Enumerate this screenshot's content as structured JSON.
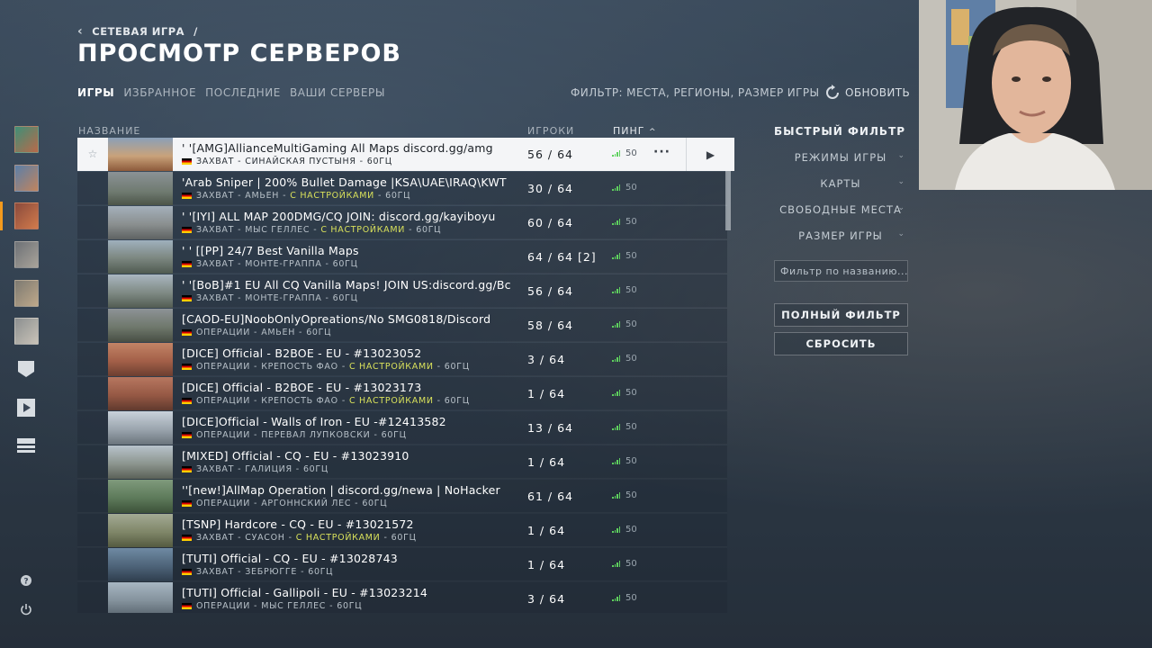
{
  "header": {
    "breadcrumb": "СЕТЕВАЯ ИГРА",
    "breadcrumb_sep": "/",
    "title": "ПРОСМОТР СЕРВЕРОВ"
  },
  "tabs": [
    {
      "label": "ИГРЫ",
      "active": true
    },
    {
      "label": "ИЗБРАННОЕ",
      "active": false
    },
    {
      "label": "ПОСЛЕДНИЕ",
      "active": false
    },
    {
      "label": "ВАШИ СЕРВЕРЫ",
      "active": false
    }
  ],
  "filter_summary": "ФИЛЬТР: МЕСТА, РЕГИОНЫ, РАЗМЕР ИГРЫ",
  "refresh_label": "ОБНОВИТЬ",
  "columns": {
    "name": "НАЗВАНИЕ",
    "players": "ИГРОКИ",
    "ping": "ПИНГ"
  },
  "servers": [
    {
      "name": "'    '[AMG]AllianceMultiGaming All Maps discord.gg/amg",
      "mode": "ЗАХВАТ",
      "map": "СИНАЙСКАЯ ПУСТЫНЯ",
      "custom": "",
      "hz": "60ГЦ",
      "players": "56 / 64",
      "ping": "50",
      "selected": true
    },
    {
      "name": " 'Arab Sniper | 200% Bullet Damage |KSA\\UAE\\IRAQ\\KWT",
      "mode": "ЗАХВАТ",
      "map": "АМЬЕН",
      "custom": "С НАСТРОЙКАМИ",
      "hz": "60ГЦ",
      "players": "30 / 64",
      "ping": "50",
      "selected": false
    },
    {
      "name": "'   '[IYI] ALL MAP 200DMG/CQ JOIN: discord.gg/kayiboyu",
      "mode": "ЗАХВАТ",
      "map": "МЫС ГЕЛЛЕС",
      "custom": "С НАСТРОЙКАМИ",
      "hz": "60ГЦ",
      "players": "60 / 64",
      "ping": "50",
      "selected": false
    },
    {
      "name": "' ' [[PP] 24/7 Best Vanilla Maps",
      "mode": "ЗАХВАТ",
      "map": "МОНТЕ-ГРАППА",
      "custom": "",
      "hz": "60ГЦ",
      "players": "64 / 64 [2]",
      "ping": "50",
      "selected": false
    },
    {
      "name": "' '[BoB]#1 EU All CQ Vanilla Maps! JOIN US:discord.gg/Bc",
      "mode": "ЗАХВАТ",
      "map": "МОНТЕ-ГРАППА",
      "custom": "",
      "hz": "60ГЦ",
      "players": "56 / 64",
      "ping": "50",
      "selected": false
    },
    {
      "name": "[CAOD-EU]NoobOnlyOpreations/No SMG0818/Discord",
      "mode": "ОПЕРАЦИИ",
      "map": "АМЬЕН",
      "custom": "",
      "hz": "60ГЦ",
      "players": "58 / 64",
      "ping": "50",
      "selected": false
    },
    {
      "name": "[DICE] Official - B2BOE - EU - #13023052",
      "mode": "ОПЕРАЦИИ",
      "map": "КРЕПОСТЬ ФАО",
      "custom": "С НАСТРОЙКАМИ",
      "hz": "60ГЦ",
      "players": "3 / 64",
      "ping": "50",
      "selected": false
    },
    {
      "name": "[DICE] Official - B2BOE - EU - #13023173",
      "mode": "ОПЕРАЦИИ",
      "map": "КРЕПОСТЬ ФАО",
      "custom": "С НАСТРОЙКАМИ",
      "hz": "60ГЦ",
      "players": "1 / 64",
      "ping": "50",
      "selected": false
    },
    {
      "name": "[DICE]Official - Walls of Iron - EU -#12413582",
      "mode": "ОПЕРАЦИИ",
      "map": "ПЕРЕВАЛ ЛУПКОВСКИ",
      "custom": "",
      "hz": "60ГЦ",
      "players": "13 / 64",
      "ping": "50",
      "selected": false
    },
    {
      "name": "[MIXED] Official - CQ - EU - #13023910",
      "mode": "ЗАХВАТ",
      "map": "ГАЛИЦИЯ",
      "custom": "",
      "hz": "60ГЦ",
      "players": "1 / 64",
      "ping": "50",
      "selected": false
    },
    {
      "name": "''[new!]AllMap Operation | discord.gg/newa | NoHacker",
      "mode": "ОПЕРАЦИИ",
      "map": "АРГОННСКИЙ ЛЕС",
      "custom": "",
      "hz": "60ГЦ",
      "players": "61 / 64",
      "ping": "50",
      "selected": false
    },
    {
      "name": "[TSNP] Hardcore - CQ - EU - #13021572",
      "mode": "ЗАХВАТ",
      "map": "СУАСОН",
      "custom": "С НАСТРОЙКАМИ",
      "hz": "60ГЦ",
      "players": "1 / 64",
      "ping": "50",
      "selected": false
    },
    {
      "name": "[TUTI] Official - CQ - EU - #13028743",
      "mode": "ЗАХВАТ",
      "map": "ЗЕБРЮГГЕ",
      "custom": "",
      "hz": "60ГЦ",
      "players": "1 / 64",
      "ping": "50",
      "selected": false
    },
    {
      "name": "[TUTI] Official - Gallipoli - EU - #13023214",
      "mode": "ОПЕРАЦИИ",
      "map": "МЫС ГЕЛЛЕС",
      "custom": "",
      "hz": "60ГЦ",
      "players": "3 / 64",
      "ping": "50",
      "selected": false
    }
  ],
  "quick_filter": {
    "title": "БЫСТРЫЙ ФИЛЬТР",
    "items": [
      "РЕЖИМЫ ИГРЫ",
      "КАРТЫ",
      "СВОБОДНЫЕ МЕСТА",
      "РАЗМЕР ИГРЫ"
    ],
    "search_placeholder": "Фильтр по названию...",
    "full_filter": "ПОЛНЫЙ ФИЛЬТР",
    "reset": "СБРОСИТЬ"
  },
  "colors": {
    "accent": "#f39a1d",
    "custom_tag": "#d8e05b",
    "ping_good": "#5ed15e"
  }
}
